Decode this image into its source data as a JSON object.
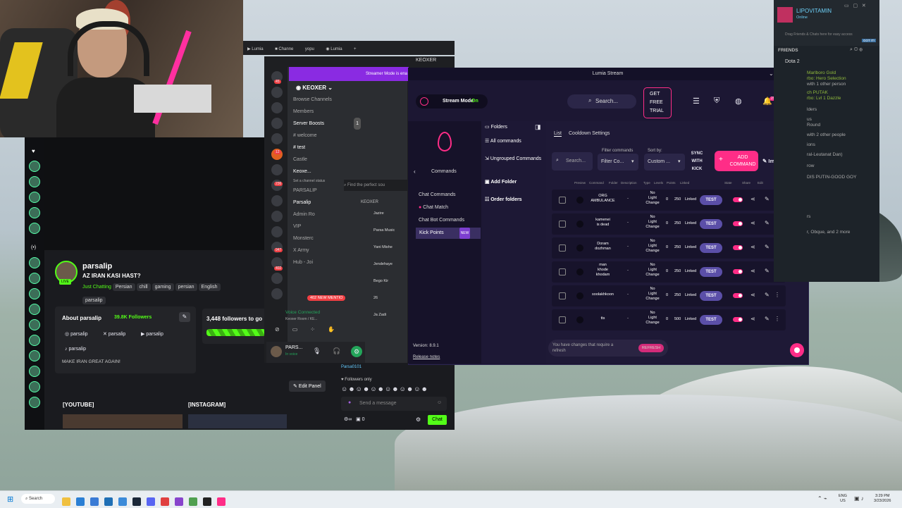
{
  "browser": {
    "tabs": [
      "Lumia",
      "Channe",
      "yopu",
      "Lumia"
    ]
  },
  "kick_profile": {
    "username": "parsalip",
    "title": "AZ IRAN KASI HAST?",
    "category": "Just Chatting",
    "tags": [
      "Persian",
      "chill",
      "gaming",
      "persian",
      "English"
    ],
    "extra_tag": "parsalip",
    "live_badge": "LIVE",
    "about_title": "About parsalip",
    "followers": "39.8K Followers",
    "socials": [
      "parsalip",
      "parsalip",
      "parsalip",
      "parsalip"
    ],
    "bio": "MAKE IRAN GREAT AGAIN!",
    "goal": "3,448 followers to go",
    "edit_panel": "Edit Panel",
    "section_youtube": "[YOUTUBE]",
    "section_instagram": "[INSTAGRAM]",
    "chat_user": "Parsa0101",
    "followers_only": "Followers only",
    "send_placeholder": "Send a message",
    "chat_button": "Chat",
    "chat_count": "0"
  },
  "discord": {
    "window_title": "KEOXER",
    "banner": "Streamer Mode is ena",
    "server": "KEOXER",
    "channels": [
      "Browse Channels",
      "Members",
      "Server Boosts",
      "welcome",
      "test",
      "Castle",
      "Keoxe...",
      "Set a channel status",
      "PARSALIP",
      "Parsalip",
      "Admin Ro",
      "VIP",
      "Monsterc",
      "X Army",
      "Hub - Joi"
    ],
    "boost_count": "1",
    "new_mentions": "402 NEW MENTIO",
    "voice_connected": "Voice Connected",
    "voice_room": "Keoxer Room / KE...",
    "user": "PARS...",
    "user_status": "In voice",
    "member_header": "KEOXER",
    "members": [
      "Jazire",
      "Parsa Music",
      "Yani Mishe",
      "Jendehaye",
      "Bego Kir",
      "26",
      "Ja Zadi"
    ],
    "search_placeholder": "Find the perfect sou",
    "server_badges": [
      "45",
      "12",
      "236",
      "947",
      "402"
    ]
  },
  "lumia": {
    "title": "Lumia Stream",
    "stream_mode": "Stream Mode",
    "stream_mode_state": "On",
    "search": "Search...",
    "trial": [
      "GET",
      "FREE",
      "TRIAL"
    ],
    "notif_count": "29",
    "nav_title": "Commands",
    "nav_items": [
      "Chat Commands",
      "Chat Match",
      "Chat Bot Commands",
      "Kick Points"
    ],
    "nav_badge": "NEW",
    "version": "Version: 8.9.1",
    "release_notes": "Release notes",
    "folders_title": "Folders",
    "folders": [
      "All commands",
      "Ungrouped Commands",
      "Add Folder",
      "Order folders"
    ],
    "tabs": [
      "List",
      "Cooldown Settings"
    ],
    "search_commands": "Search...",
    "filter_label": "Filter commands",
    "filter_value": "Filter Co...",
    "sort_label": "Sort by:",
    "sort_value": "Custom ...",
    "sync": [
      "SYNC",
      "WITH",
      "KICK"
    ],
    "add_command": [
      "ADD",
      "COMMAND"
    ],
    "import": "Import",
    "headers": [
      "Preview",
      "Command",
      "Folder",
      "Description",
      "Type",
      "Levels",
      "Points",
      "Linked",
      "State",
      "Share",
      "Edit"
    ],
    "commands": [
      {
        "name": [
          "ORG",
          "AMBULANCE"
        ],
        "type": [
          "No",
          "Light",
          "Change"
        ],
        "levels": "0",
        "points": "250",
        "linked": "Linked"
      },
      {
        "name": [
          "kamenei",
          "is dead"
        ],
        "type": [
          "No",
          "Light",
          "Change"
        ],
        "levels": "0",
        "points": "250",
        "linked": "Linked"
      },
      {
        "name": [
          "Doram",
          "dozhman"
        ],
        "type": [
          "No",
          "Light",
          "Change"
        ],
        "levels": "0",
        "points": "250",
        "linked": "Linked"
      },
      {
        "name": [
          "man",
          "khode",
          "khodam"
        ],
        "type": [
          "No",
          "Light",
          "Change"
        ],
        "levels": "0",
        "points": "250",
        "linked": "Linked"
      },
      {
        "name": [
          "soolakhkoon"
        ],
        "type": [
          "No",
          "Light",
          "Change"
        ],
        "levels": "0",
        "points": "250",
        "linked": "Linked"
      },
      {
        "name": [
          "tts"
        ],
        "type": [
          "No",
          "Light",
          "Change"
        ],
        "levels": "0",
        "points": "500",
        "linked": "Linked"
      }
    ],
    "test_label": "TEST",
    "changes": [
      "You have changes that require a",
      "refresh"
    ],
    "refresh": "REFRESH"
  },
  "steam": {
    "user": "LIPOVITAMIN",
    "status": "Online",
    "drag_hint": "Drag Friends & Chats here for easy access",
    "got_it": "GOT IT!",
    "friends": "FRIENDS",
    "game": "Dota 2",
    "lines": [
      "Marlboro Gold",
      "rbo: Hero Selection",
      "with 1 other person",
      "ch PUTAK",
      "rbo: Lvl 1 Dazzle",
      "lders",
      "us",
      "Round",
      "with 2 other people",
      "ions",
      "ral-Leutanat Dan)",
      "row",
      "DIS PUTIN-GOOD GOY",
      "rs",
      "r, Obque, and 2 more"
    ]
  },
  "taskbar": {
    "search": "Search",
    "lang": [
      "ENG",
      "US"
    ],
    "time": "3:29 PM",
    "date": "3/23/2026"
  }
}
